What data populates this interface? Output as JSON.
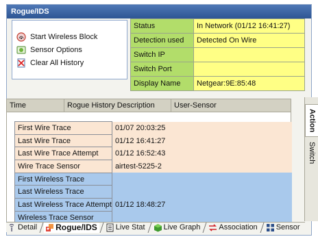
{
  "window": {
    "title": "Rogue/IDS"
  },
  "actions": [
    {
      "label": "Start Wireless Block",
      "icon": "wireless-block-icon"
    },
    {
      "label": "Sensor Options",
      "icon": "sensor-options-icon"
    },
    {
      "label": "Clear All History",
      "icon": "clear-history-icon"
    }
  ],
  "status": [
    {
      "key": "Status",
      "value": "In Network (01/12 16:41:27)"
    },
    {
      "key": "Detection used",
      "value": "Detected On Wire"
    },
    {
      "key": "Switch IP",
      "value": ""
    },
    {
      "key": "Switch Port",
      "value": ""
    },
    {
      "key": "Display Name",
      "value": "Netgear:9E:85:48"
    }
  ],
  "history": {
    "columns": [
      "Time",
      "Rogue History Description",
      "User-Sensor"
    ]
  },
  "details": [
    {
      "key": "First Wire Trace",
      "value": "01/07 20:03:25",
      "type": "wire"
    },
    {
      "key": "Last Wire Trace",
      "value": "01/12 16:41:27",
      "type": "wire"
    },
    {
      "key": "Last Wire Trace Attempt",
      "value": "01/12 16:52:43",
      "type": "wire"
    },
    {
      "key": "Wire Trace Sensor",
      "value": "airtest-5225-2",
      "type": "wire"
    },
    {
      "key": "First Wireless Trace",
      "value": "",
      "type": "wireless"
    },
    {
      "key": "Last Wireless Trace",
      "value": "",
      "type": "wireless"
    },
    {
      "key": "Last Wireless Trace Attempt",
      "value": "01/12 18:48:27",
      "type": "wireless"
    },
    {
      "key": "Wireless Trace Sensor",
      "value": "",
      "type": "wireless"
    }
  ],
  "side_tabs": [
    {
      "label": "Action",
      "active": true
    },
    {
      "label": "Switch",
      "active": false
    }
  ],
  "bottom_tabs": [
    {
      "label": "Detail",
      "icon": "detail-icon",
      "active": false
    },
    {
      "label": "Rogue/IDS",
      "icon": "rogue-ids-icon",
      "active": true
    },
    {
      "label": "Live Stat",
      "icon": "live-stat-icon",
      "active": false
    },
    {
      "label": "Live Graph",
      "icon": "live-graph-icon",
      "active": false
    },
    {
      "label": "Association",
      "icon": "association-icon",
      "active": false
    },
    {
      "label": "Sensor",
      "icon": "sensor-icon",
      "active": false
    }
  ],
  "colors": {
    "title_bar": "#3a64a4",
    "status_key_bg": "#b2dd6a",
    "status_value_bg": "#ffff85",
    "wire_row_bg": "#fbe6d3",
    "wireless_row_bg": "#a9c9ec"
  }
}
